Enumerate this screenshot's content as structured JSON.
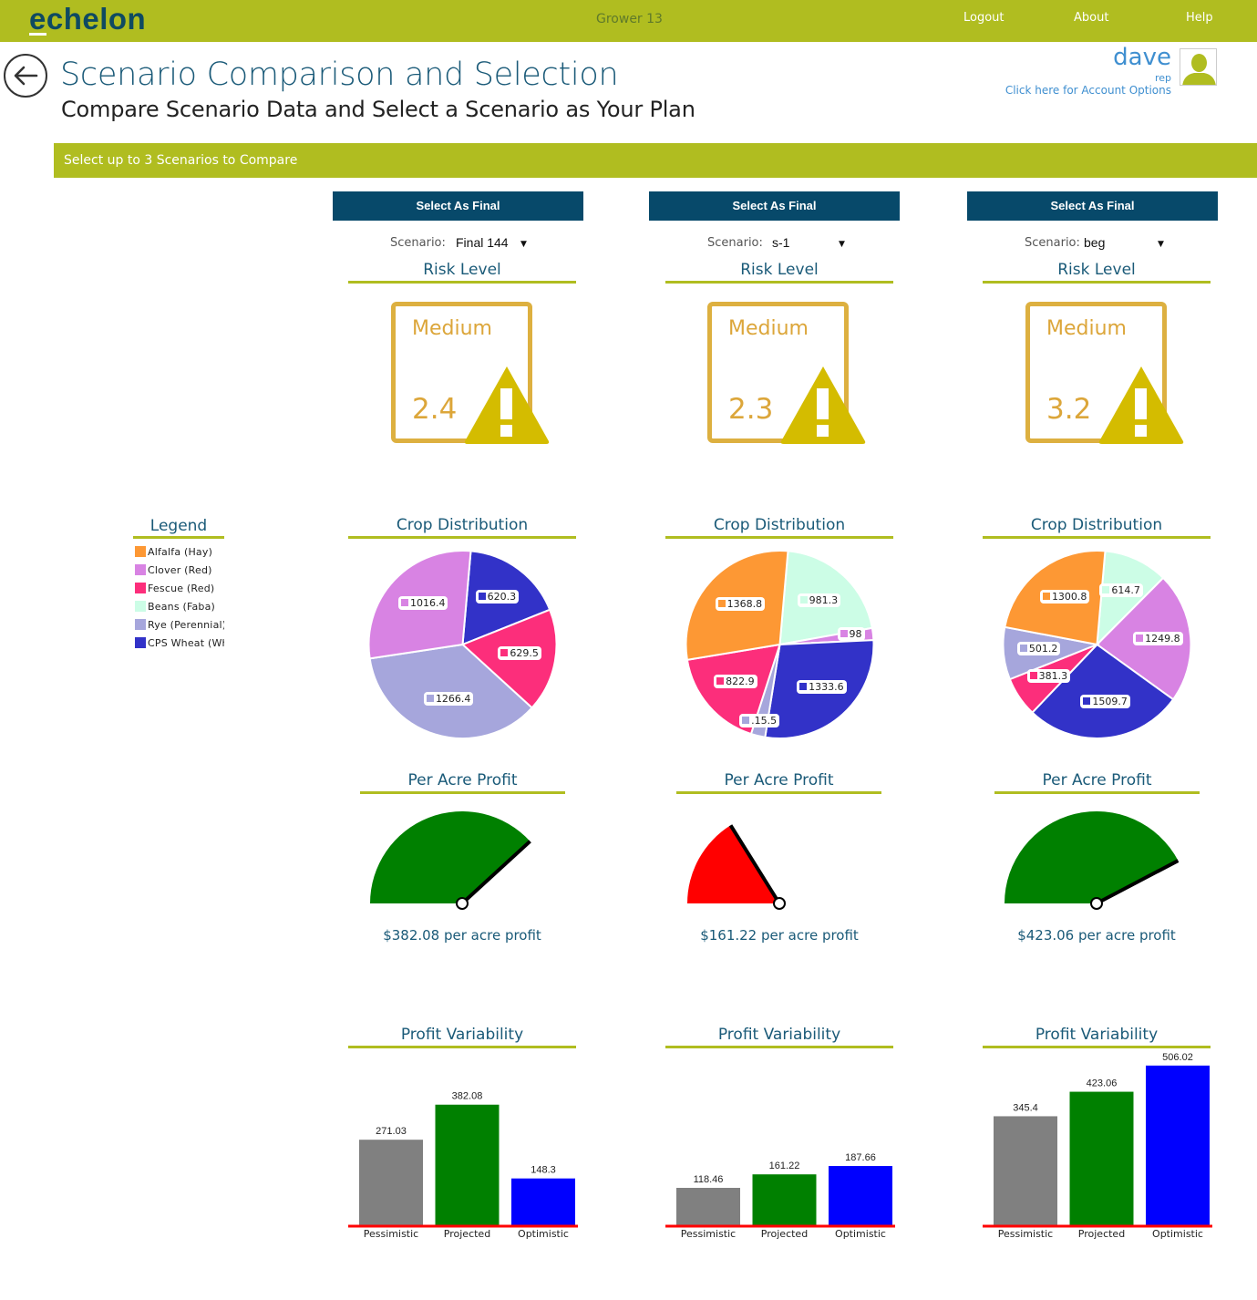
{
  "app": {
    "logo_first": "e",
    "logo_rest": "chelon",
    "context": "Grower 13",
    "nav": [
      {
        "label": "Logout"
      },
      {
        "label": "About"
      },
      {
        "label": "Help"
      }
    ],
    "brand_color": "#b0bd20"
  },
  "header": {
    "title": "Scenario Comparison and Selection",
    "subtitle": "Compare Scenario Data and Select a Scenario as Your Plan",
    "back_icon": "arrow-left-circle-icon"
  },
  "user": {
    "name": "dave",
    "role": "rep",
    "account_link": "Click here for Account Options",
    "avatar_icon": "user-silhouette-icon"
  },
  "banner": {
    "text": "Select up to 3 Scenarios to Compare"
  },
  "legend": {
    "title": "Legend",
    "items": [
      {
        "label": "Alfalfa (Hay)",
        "color": "#fd9834"
      },
      {
        "label": "Clover (Red)",
        "color": "#d883e3"
      },
      {
        "label": "Fescue (Red)",
        "color": "#fc2e7b"
      },
      {
        "label": "Beans (Faba)",
        "color": "#ccfde6"
      },
      {
        "label": "Rye (Perennial)",
        "color": "#a6a6dc"
      },
      {
        "label": "CPS Wheat (Wh",
        "color": "#3232c8"
      }
    ]
  },
  "labels": {
    "select_final": "Select As Final",
    "scenario_label": "Scenario:",
    "risk_title": "Risk Level",
    "crop_title": "Crop Distribution",
    "profit_title": "Per Acre Profit",
    "variability_title": "Profit Variability",
    "per_acre_suffix": " per acre profit"
  },
  "scenarios": [
    {
      "name": "Final 144",
      "risk": {
        "level": "Medium",
        "score": "2.4"
      },
      "profit_text": "$382.08",
      "gauge": {
        "value": 382.08,
        "max": 500,
        "color": "#008000"
      }
    },
    {
      "name": "s-1",
      "risk": {
        "level": "Medium",
        "score": "2.3"
      },
      "profit_text": "$161.22",
      "gauge": {
        "value": 161.22,
        "max": 500,
        "color": "#ff0000"
      }
    },
    {
      "name": "beg",
      "risk": {
        "level": "Medium",
        "score": "3.2"
      },
      "profit_text": "$423.06",
      "gauge": {
        "value": 423.06,
        "max": 500,
        "color": "#008000"
      }
    }
  ],
  "chart_data": [
    {
      "type": "pie",
      "title": "Crop Distribution",
      "scenario": "Final 144",
      "slices": [
        {
          "label": "CPS Wheat (Wh",
          "value": 620.3,
          "color": "#3232c8"
        },
        {
          "label": "Fescue (Red)",
          "value": 629.5,
          "color": "#fc2e7b"
        },
        {
          "label": "Rye (Perennial)",
          "value": 1266.4,
          "color": "#a6a6dc"
        },
        {
          "label": "Clover (Red)",
          "value": 1016.4,
          "color": "#d883e3"
        }
      ]
    },
    {
      "type": "pie",
      "title": "Crop Distribution",
      "scenario": "s-1",
      "slices": [
        {
          "label": "Beans (Faba)",
          "value": 981.3,
          "color": "#ccfde6"
        },
        {
          "label": "Clover (Red)",
          "value": 98,
          "color": "#d883e3"
        },
        {
          "label": "CPS Wheat (Wh",
          "value": 1333.6,
          "color": "#3232c8"
        },
        {
          "label": "Rye (Perennial)",
          "value": 115.5,
          "color": "#a6a6dc",
          "display": ".15.5"
        },
        {
          "label": "Fescue (Red)",
          "value": 822.9,
          "color": "#fc2e7b"
        },
        {
          "label": "Alfalfa (Hay)",
          "value": 1368.8,
          "color": "#fd9834"
        }
      ]
    },
    {
      "type": "pie",
      "title": "Crop Distribution",
      "scenario": "beg",
      "slices": [
        {
          "label": "Beans (Faba)",
          "value": 614.7,
          "color": "#ccfde6"
        },
        {
          "label": "Clover (Red)",
          "value": 1249.8,
          "color": "#d883e3"
        },
        {
          "label": "CPS Wheat (Wh",
          "value": 1509.7,
          "color": "#3232c8"
        },
        {
          "label": "Fescue (Red)",
          "value": 381.3,
          "color": "#fc2e7b"
        },
        {
          "label": "Rye (Perennial)",
          "value": 501.2,
          "color": "#a6a6dc"
        },
        {
          "label": "Alfalfa (Hay)",
          "value": 1300.8,
          "color": "#fd9834"
        }
      ]
    },
    {
      "type": "bar",
      "title": "Profit Variability",
      "scenario": "Final 144",
      "categories": [
        "Pessimistic",
        "Projected",
        "Optimistic"
      ],
      "values": [
        271.03,
        382.08,
        148.3
      ],
      "value_labels": [
        "271.03",
        "382.08",
        "148.3"
      ],
      "colors": [
        "#808080",
        "#008000",
        "#0000ff"
      ],
      "ylim": [
        0,
        520
      ]
    },
    {
      "type": "bar",
      "title": "Profit Variability",
      "scenario": "s-1",
      "categories": [
        "Pessimistic",
        "Projected",
        "Optimistic"
      ],
      "values": [
        118.46,
        161.22,
        187.66
      ],
      "value_labels": [
        "118.46",
        "161.22",
        "187.66"
      ],
      "colors": [
        "#808080",
        "#008000",
        "#0000ff"
      ],
      "ylim": [
        0,
        520
      ]
    },
    {
      "type": "bar",
      "title": "Profit Variability",
      "scenario": "beg",
      "categories": [
        "Pessimistic",
        "Projected",
        "Optimistic"
      ],
      "values": [
        345.4,
        423.06,
        506.02
      ],
      "value_labels": [
        "345.4",
        "423.06",
        "506.02"
      ],
      "colors": [
        "#808080",
        "#008000",
        "#0000ff"
      ],
      "ylim": [
        0,
        520
      ]
    }
  ]
}
